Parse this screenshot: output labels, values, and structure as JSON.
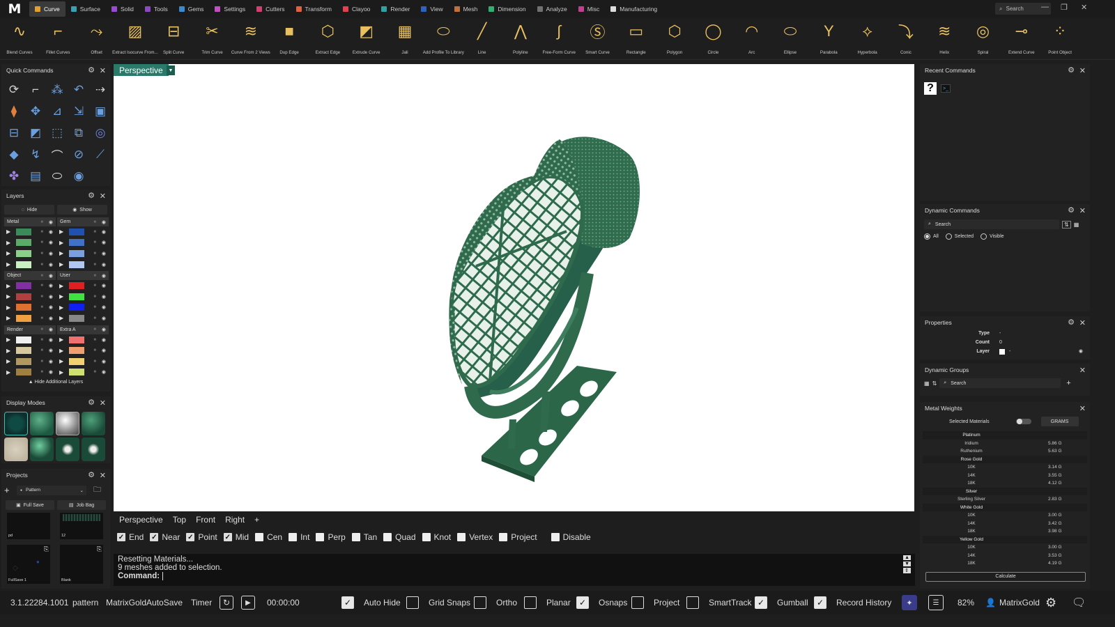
{
  "app": {
    "logo": "M"
  },
  "menu_tabs": [
    {
      "label": "Curve",
      "color": "#e0a030",
      "active": true
    },
    {
      "label": "Surface",
      "color": "#3aa0b0"
    },
    {
      "label": "Solid",
      "color": "#9a4ad0"
    },
    {
      "label": "Tools",
      "color": "#8a4ac0"
    },
    {
      "label": "Gems",
      "color": "#3a8ad0"
    },
    {
      "label": "Settings",
      "color": "#c050c0"
    },
    {
      "label": "Cutters",
      "color": "#d04070"
    },
    {
      "label": "Transform",
      "color": "#e06040"
    },
    {
      "label": "Clayoo",
      "color": "#e04050"
    },
    {
      "label": "Render",
      "color": "#30a0a0"
    },
    {
      "label": "View",
      "color": "#3060c0"
    },
    {
      "label": "Mesh",
      "color": "#c07040"
    },
    {
      "label": "Dimension",
      "color": "#30b070"
    },
    {
      "label": "Analyze",
      "color": "#707070"
    },
    {
      "label": "Misc",
      "color": "#c04090"
    },
    {
      "label": "Manufacturing",
      "color": "#dddddd"
    }
  ],
  "title_search": "Search",
  "toolbar": [
    {
      "label": "Blend Curves",
      "icon": "blend-curves-icon"
    },
    {
      "label": "Fillet Curves",
      "icon": "fillet-curves-icon"
    },
    {
      "label": "Offset",
      "icon": "offset-icon"
    },
    {
      "label": "Extract Isocurve From...",
      "icon": "extract-isocurve-icon"
    },
    {
      "label": "Split Curve",
      "icon": "split-curve-icon"
    },
    {
      "label": "Trim Curve",
      "icon": "trim-curve-icon"
    },
    {
      "label": "Curve From 2 Views",
      "icon": "curve-from-2-views-icon"
    },
    {
      "label": "Dup Edge",
      "icon": "dup-edge-icon"
    },
    {
      "label": "Extract Edge",
      "icon": "extract-edge-icon"
    },
    {
      "label": "Extrude Curve",
      "icon": "extrude-curve-icon"
    },
    {
      "label": "Jali",
      "icon": "jali-icon"
    },
    {
      "label": "Add Profile To Library",
      "icon": "add-profile-icon"
    },
    {
      "label": "Line",
      "icon": "line-icon"
    },
    {
      "label": "Polyline",
      "icon": "polyline-icon"
    },
    {
      "label": "Free-Form Curve",
      "icon": "free-form-curve-icon"
    },
    {
      "label": "Smart Curve",
      "icon": "smart-curve-icon"
    },
    {
      "label": "Rectangle",
      "icon": "rectangle-icon"
    },
    {
      "label": "Polygon",
      "icon": "polygon-icon"
    },
    {
      "label": "Circle",
      "icon": "circle-icon"
    },
    {
      "label": "Arc",
      "icon": "arc-icon"
    },
    {
      "label": "Ellipse",
      "icon": "ellipse-icon"
    },
    {
      "label": "Parabola",
      "icon": "parabola-icon"
    },
    {
      "label": "Hyperbola",
      "icon": "hyperbola-icon"
    },
    {
      "label": "Conic",
      "icon": "conic-icon"
    },
    {
      "label": "Helix",
      "icon": "helix-icon"
    },
    {
      "label": "Spiral",
      "icon": "spiral-icon"
    },
    {
      "label": "Extend Curve",
      "icon": "extend-curve-icon"
    },
    {
      "label": "Point Object",
      "icon": "point-object-icon"
    }
  ],
  "quick_commands": {
    "title": "Quick Commands"
  },
  "layers": {
    "title": "Layers",
    "hide_label": "Hide",
    "show_label": "Show",
    "groups": [
      {
        "name": "Metal",
        "colors": [
          "#3b8a5a",
          "#5aaa6a",
          "#8ad08a",
          "#c8f0c0"
        ]
      },
      {
        "name": "Gem",
        "colors": [
          "#2050b0",
          "#4070c8",
          "#7aa0e0",
          "#b0c8f0"
        ]
      },
      {
        "name": "Object",
        "colors": [
          "#8030a0",
          "#b04040",
          "#e07030",
          "#f0a040"
        ]
      },
      {
        "name": "User",
        "colors": [
          "#e02020",
          "#40e040",
          "#1020f0",
          "#888888"
        ]
      },
      {
        "name": "Render",
        "colors": [
          "#f0f0f0",
          "#d8c8a0",
          "#b09860",
          "#a08040"
        ]
      },
      {
        "name": "Extra A",
        "colors": [
          "#f07070",
          "#f0a070",
          "#f0d070",
          "#d0e070"
        ]
      }
    ],
    "footer": "Hide Additional Layers"
  },
  "display_modes": {
    "title": "Display Modes"
  },
  "projects": {
    "title": "Projects",
    "dropdown": "Pattern",
    "full_save": "Full Save",
    "job_bag": "Job Bag",
    "thumbs": [
      "pd",
      "12",
      "FullSave 1",
      "Blank"
    ]
  },
  "viewport": {
    "active_tab": "Perspective"
  },
  "view_tabs": [
    "Perspective",
    "Top",
    "Front",
    "Right",
    "+"
  ],
  "snaps": [
    {
      "label": "End",
      "on": true
    },
    {
      "label": "Near",
      "on": true
    },
    {
      "label": "Point",
      "on": true
    },
    {
      "label": "Mid",
      "on": true
    },
    {
      "label": "Cen",
      "on": false
    },
    {
      "label": "Int",
      "on": false
    },
    {
      "label": "Perp",
      "on": false
    },
    {
      "label": "Tan",
      "on": false
    },
    {
      "label": "Quad",
      "on": false
    },
    {
      "label": "Knot",
      "on": false
    },
    {
      "label": "Vertex",
      "on": false
    },
    {
      "label": "Project",
      "on": false
    },
    {
      "label": "Disable",
      "on": false
    }
  ],
  "command": {
    "history": [
      "Resetting Materials...",
      "9 meshes added to selection."
    ],
    "prompt": "Command:"
  },
  "status": {
    "version": "3.1.22284.1001",
    "project": "pattern",
    "autosave": "MatrixGoldAutoSave",
    "timer_label": "Timer",
    "timer_value": "00:00:00",
    "toggles": [
      {
        "label": "Auto Hide",
        "on": true
      },
      {
        "label": "Grid Snaps",
        "on": false
      },
      {
        "label": "Ortho",
        "on": false
      },
      {
        "label": "Planar",
        "on": false
      },
      {
        "label": "Osnaps",
        "on": true
      },
      {
        "label": "Project",
        "on": false
      },
      {
        "label": "SmartTrack",
        "on": false
      },
      {
        "label": "Gumball",
        "on": true
      },
      {
        "label": "Record History",
        "on": true
      }
    ],
    "zoom": "82%",
    "user": "MatrixGold"
  },
  "recent_commands": {
    "title": "Recent Commands"
  },
  "dynamic_commands": {
    "title": "Dynamic Commands",
    "search": "Search",
    "filters": [
      {
        "label": "All",
        "on": true
      },
      {
        "label": "Selected",
        "on": false
      },
      {
        "label": "Visible",
        "on": false
      }
    ]
  },
  "properties": {
    "title": "Properties",
    "type_label": "Type",
    "type_value": "-",
    "count_label": "Count",
    "count_value": "0",
    "layer_label": "Layer",
    "layer_value": "-"
  },
  "dynamic_groups": {
    "title": "Dynamic Groups",
    "search": "Search"
  },
  "metal_weights": {
    "title": "Metal Weights",
    "selected_label": "Selected Materials",
    "unit": "GRAMS",
    "rows": [
      {
        "name": "Platinum",
        "value": "",
        "header": true
      },
      {
        "name": "Iridium",
        "value": "5.86 G"
      },
      {
        "name": "Ruthenium",
        "value": "5.63 G"
      },
      {
        "name": "Rose Gold",
        "value": "",
        "header": true
      },
      {
        "name": "10K",
        "value": "3.14 G"
      },
      {
        "name": "14K",
        "value": "3.55 G"
      },
      {
        "name": "18K",
        "value": "4.12 G"
      },
      {
        "name": "Silver",
        "value": "",
        "header": true
      },
      {
        "name": "Sterling Silver",
        "value": "2.83 G"
      },
      {
        "name": "White Gold",
        "value": "",
        "header": true
      },
      {
        "name": "10K",
        "value": "3.00 G"
      },
      {
        "name": "14K",
        "value": "3.42 G"
      },
      {
        "name": "18K",
        "value": "3.98 G"
      },
      {
        "name": "Yellow Gold",
        "value": "",
        "header": true
      },
      {
        "name": "10K",
        "value": "3.00 G"
      },
      {
        "name": "14K",
        "value": "3.53 G"
      },
      {
        "name": "18K",
        "value": "4.19 G"
      }
    ],
    "calculate": "Calculate"
  }
}
